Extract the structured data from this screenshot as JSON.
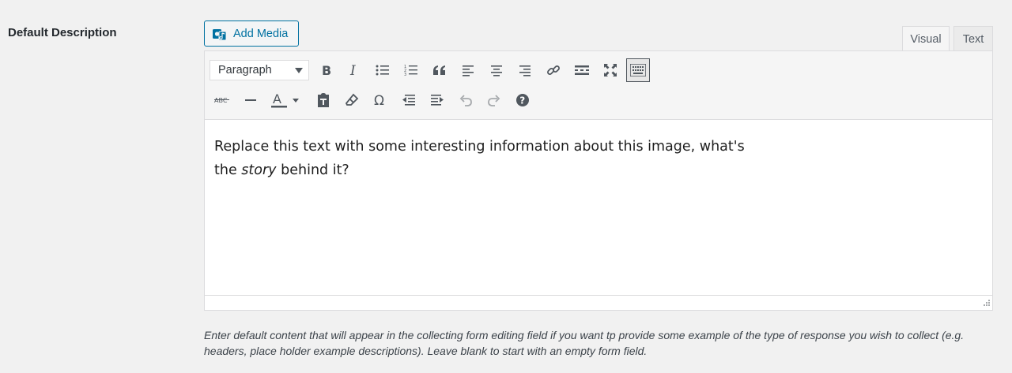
{
  "field": {
    "label": "Default Description"
  },
  "media": {
    "button_label": "Add Media"
  },
  "tabs": [
    {
      "label": "Visual",
      "active": true
    },
    {
      "label": "Text",
      "active": false
    }
  ],
  "toolbar": {
    "format_select": "Paragraph",
    "row1": [
      "bold-icon",
      "italic-icon",
      "bulleted-list-icon",
      "numbered-list-icon",
      "blockquote-icon",
      "align-left-icon",
      "align-center-icon",
      "align-right-icon",
      "link-icon",
      "read-more-icon",
      "fullscreen-icon",
      "toolbar-toggle-icon"
    ],
    "row2": [
      "strikethrough-icon",
      "horizontal-line-icon",
      "text-color-icon",
      "paste-as-text-icon",
      "clear-formatting-icon",
      "special-character-icon",
      "outdent-icon",
      "indent-icon",
      "undo-icon",
      "redo-icon",
      "help-icon"
    ]
  },
  "editor": {
    "line1": "Replace this text with some interesting information about this image, what's",
    "line2_before": "the ",
    "line2_italic": "story",
    "line2_after": " behind it?"
  },
  "help": {
    "text": "Enter default content that will appear in the collecting form editing field if you want tp provide some example of the type of response you wish to collect (e.g. headers, place holder example descriptions). Leave blank to start with an empty form field."
  }
}
